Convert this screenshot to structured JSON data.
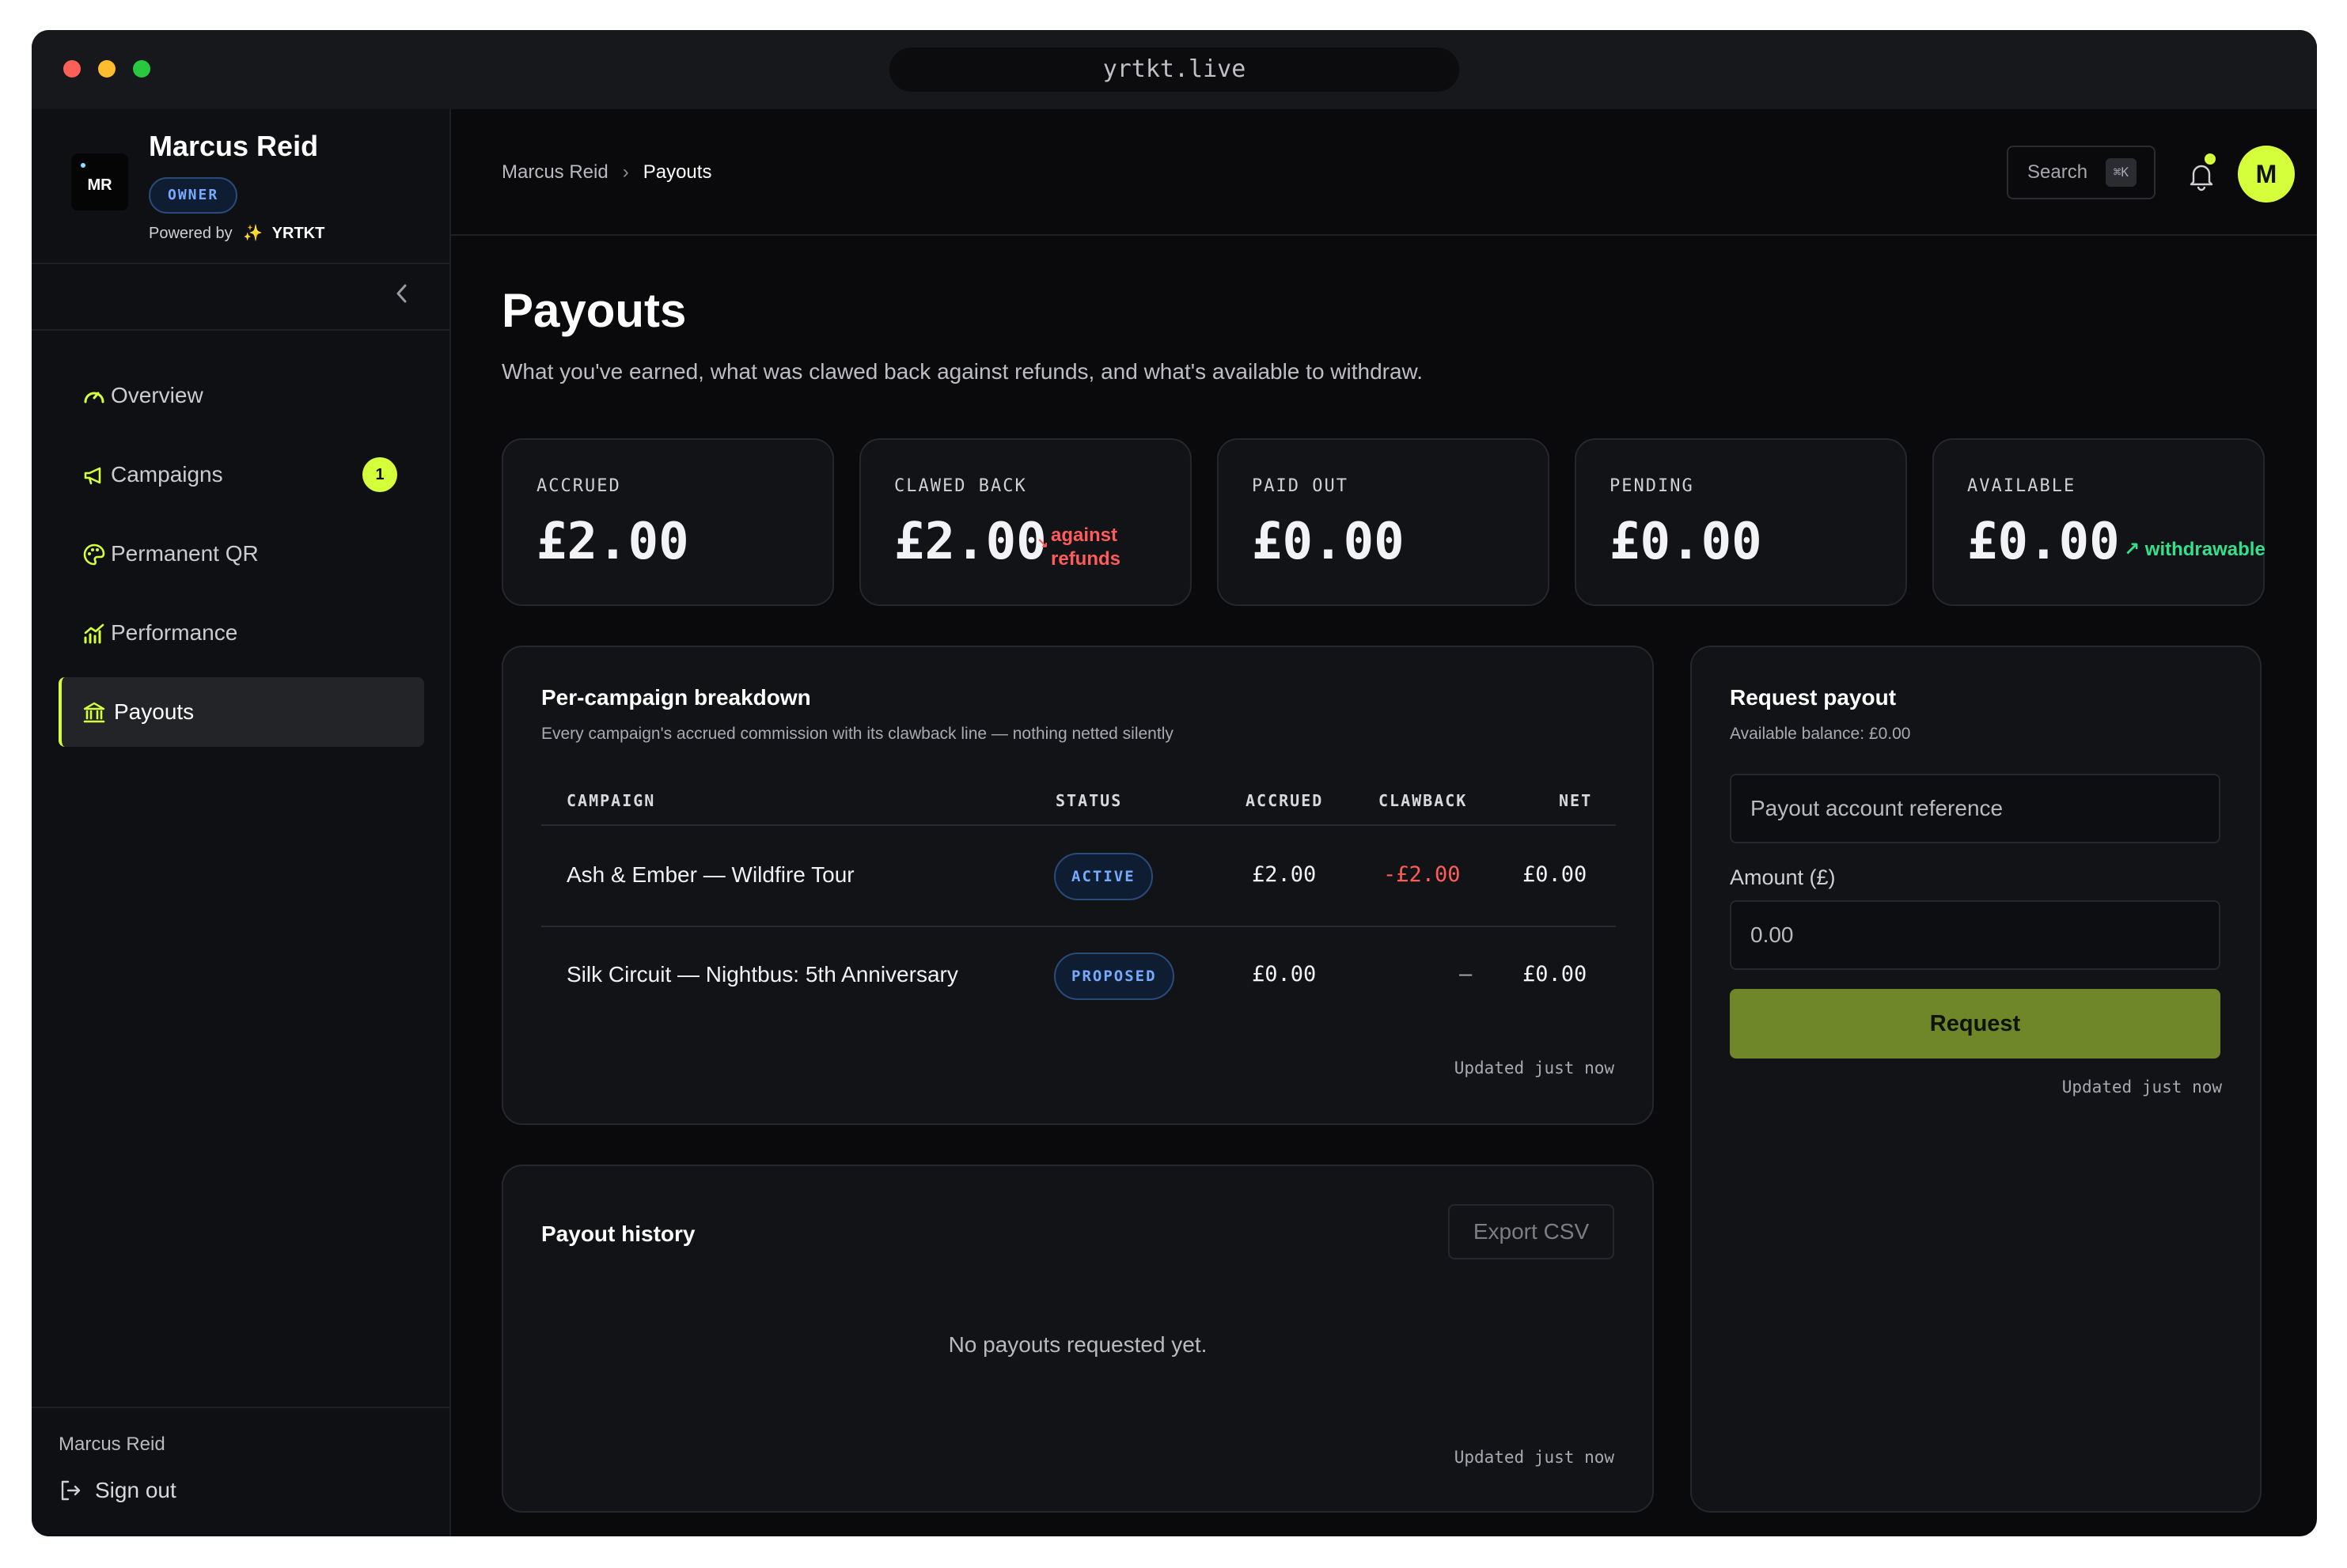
{
  "window": {
    "url": "yrtkt.live"
  },
  "sidebar": {
    "brand_name": "Marcus Reid",
    "logo_text": "MR",
    "role_badge": "OWNER",
    "powered_by": "Powered by",
    "powered_brand": "YRTKT",
    "items": [
      {
        "label": "Overview",
        "icon": "gauge-icon"
      },
      {
        "label": "Campaigns",
        "icon": "megaphone-icon",
        "badge": "1"
      },
      {
        "label": "Permanent QR",
        "icon": "palette-icon"
      },
      {
        "label": "Performance",
        "icon": "chart-icon"
      },
      {
        "label": "Payouts",
        "icon": "bank-icon",
        "active": true
      }
    ],
    "footer_user": "Marcus Reid",
    "sign_out": "Sign out"
  },
  "topbar": {
    "breadcrumb_root": "Marcus Reid",
    "breadcrumb_current": "Payouts",
    "search_label": "Search",
    "search_shortcut": "⌘K",
    "avatar_initial": "M"
  },
  "page": {
    "title": "Payouts",
    "subtitle": "What you've earned, what was clawed back against refunds, and what's available to withdraw."
  },
  "stats": [
    {
      "label": "ACCRUED",
      "value": "£2.00"
    },
    {
      "label": "CLAWED BACK",
      "value": "£2.00",
      "note_line1": "against",
      "note_line2": "refunds"
    },
    {
      "label": "PAID OUT",
      "value": "£0.00"
    },
    {
      "label": "PENDING",
      "value": "£0.00"
    },
    {
      "label": "AVAILABLE",
      "value": "£0.00",
      "note": "↗ withdrawable"
    }
  ],
  "breakdown": {
    "title": "Per-campaign breakdown",
    "subtitle": "Every campaign's accrued commission with its clawback line — nothing netted silently",
    "columns": {
      "campaign": "CAMPAIGN",
      "status": "STATUS",
      "accrued": "ACCRUED",
      "clawback": "CLAWBACK",
      "net": "NET"
    },
    "rows": [
      {
        "campaign": "Ash & Ember — Wildfire Tour",
        "status": "ACTIVE",
        "accrued": "£2.00",
        "clawback": "-£2.00",
        "net": "£0.00"
      },
      {
        "campaign": "Silk Circuit — Nightbus: 5th Anniversary",
        "status": "PROPOSED",
        "accrued": "£0.00",
        "clawback": "—",
        "net": "£0.00"
      }
    ],
    "updated": "Updated just now"
  },
  "history": {
    "title": "Payout history",
    "export_label": "Export CSV",
    "empty": "No payouts requested yet.",
    "updated": "Updated just now"
  },
  "request": {
    "title": "Request payout",
    "balance": "Available balance: £0.00",
    "account_placeholder": "Payout account reference",
    "amount_label": "Amount (£)",
    "amount_placeholder": "0.00",
    "button": "Request",
    "updated": "Updated just now"
  },
  "colors": {
    "accent": "#d4ff3a",
    "button": "#6f8629",
    "negative": "#ff5b5b",
    "positive": "#33e08c",
    "badge_blue": "#77aaff"
  }
}
